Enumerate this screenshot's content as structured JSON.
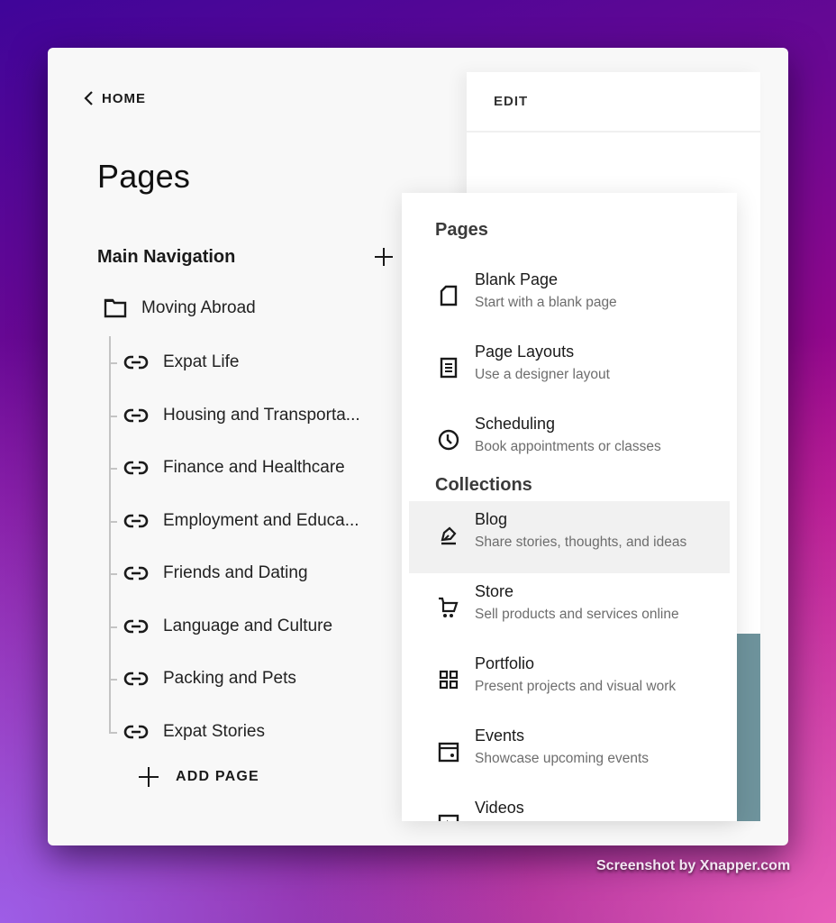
{
  "left_panel": {
    "back_label": "HOME",
    "title": "Pages",
    "nav_section": "Main Navigation",
    "folder": "Moving Abroad",
    "pages": [
      "Expat Life",
      "Housing and Transporta...",
      "Finance and Healthcare",
      "Employment and Educa...",
      "Friends and Dating",
      "Language and Culture",
      "Packing and Pets",
      "Expat Stories"
    ],
    "add_page_label": "ADD PAGE"
  },
  "preview": {
    "edit_label": "EDIT",
    "accent_color": "#6e939c"
  },
  "menu": {
    "pages_title": "Pages",
    "collections_title": "Collections",
    "page_items": [
      {
        "icon": "blank-page-icon",
        "name": "Blank Page",
        "desc": "Start with a blank page"
      },
      {
        "icon": "page-layouts-icon",
        "name": "Page Layouts",
        "desc": "Use a designer layout"
      },
      {
        "icon": "clock-icon",
        "name": "Scheduling",
        "desc": "Book appointments or classes"
      }
    ],
    "collection_items": [
      {
        "icon": "pen-icon",
        "name": "Blog",
        "desc": "Share stories, thoughts, and ideas",
        "active": true
      },
      {
        "icon": "cart-icon",
        "name": "Store",
        "desc": "Sell products and services online"
      },
      {
        "icon": "grid-icon",
        "name": "Portfolio",
        "desc": "Present projects and visual work"
      },
      {
        "icon": "calendar-icon",
        "name": "Events",
        "desc": "Showcase upcoming events"
      },
      {
        "icon": "video-icon",
        "name": "Videos",
        "desc": ""
      }
    ]
  },
  "watermark": "Screenshot by Xnapper.com"
}
